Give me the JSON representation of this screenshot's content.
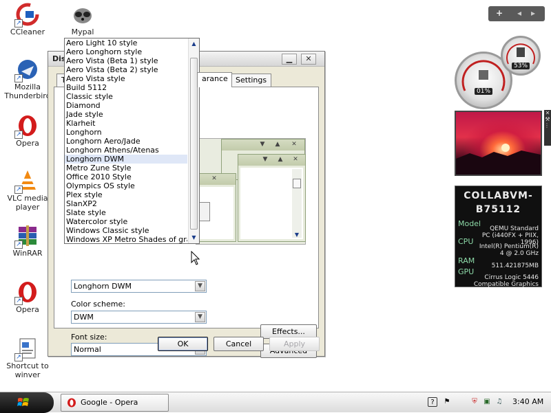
{
  "desktop": {
    "icons": [
      {
        "label": "CCleaner"
      },
      {
        "label": "Mypal"
      },
      {
        "label": "Mozilla Thunderbird"
      },
      {
        "label": "Opera"
      },
      {
        "label": "VLC media player"
      },
      {
        "label": "WinRAR"
      },
      {
        "label": "Opera"
      },
      {
        "label": "Shortcut to winver"
      }
    ]
  },
  "dialog": {
    "title": "Dis",
    "tabs": [
      {
        "label": "T"
      },
      {
        "label": "arance"
      },
      {
        "label": "Settings"
      }
    ],
    "window_style": {
      "value": "Longhorn DWM"
    },
    "color_scheme": {
      "label": "Color scheme:",
      "value": "DWM"
    },
    "font_size": {
      "label": "Font size:",
      "value": "Normal"
    },
    "effects_label": "Effects...",
    "advanced_label": "Advanced",
    "ok_label": "OK",
    "cancel_label": "Cancel",
    "apply_label": "Apply"
  },
  "dropdown": {
    "selected": "Longhorn DWM",
    "items": [
      "Aero Light 10 style",
      "Aero Longhorn style",
      "Aero Vista (Beta 1) style",
      "Aero Vista (Beta 2) style",
      "Aero Vista style",
      "Build 5112",
      "Classic style",
      "Diamond",
      "Jade style",
      "Klarheit",
      "Longhorn",
      "Longhorn Aero/Jade",
      "Longhorn Athens/Atenas",
      "Longhorn DWM",
      "Metro Zune Style",
      "Office 2010 Style",
      "Olympics OS style",
      "Plex style",
      "SlanXP2",
      "Slate style",
      "Watercolor style",
      "Windows Classic style",
      "Windows XP Metro Shades of gray st"
    ]
  },
  "gadgets": {
    "cpu_percent": "01%",
    "mem_percent": "53%",
    "system": {
      "hostname_line1": "COLLABVM-",
      "hostname_line2": "B75112",
      "model_key": "Model",
      "model_value": "QEMU Standard PC (i440FX + PIIX, 1996)",
      "cpu_key": "CPU",
      "cpu_value": "Intel(R) Pentium(R) 4 @ 2.0 GHz",
      "ram_key": "RAM",
      "ram_value": "511.421875MB",
      "gpu_key": "GPU",
      "gpu_value": "Cirrus Logic 5446 Compatible Graphics"
    }
  },
  "taskbar": {
    "task_label": "Google - Opera",
    "clock": "3:40 AM"
  },
  "colors": {
    "selection": "#dfe7f7",
    "dialog_bg": "#ece9d8",
    "gadget_green": "#8ddaa8"
  }
}
